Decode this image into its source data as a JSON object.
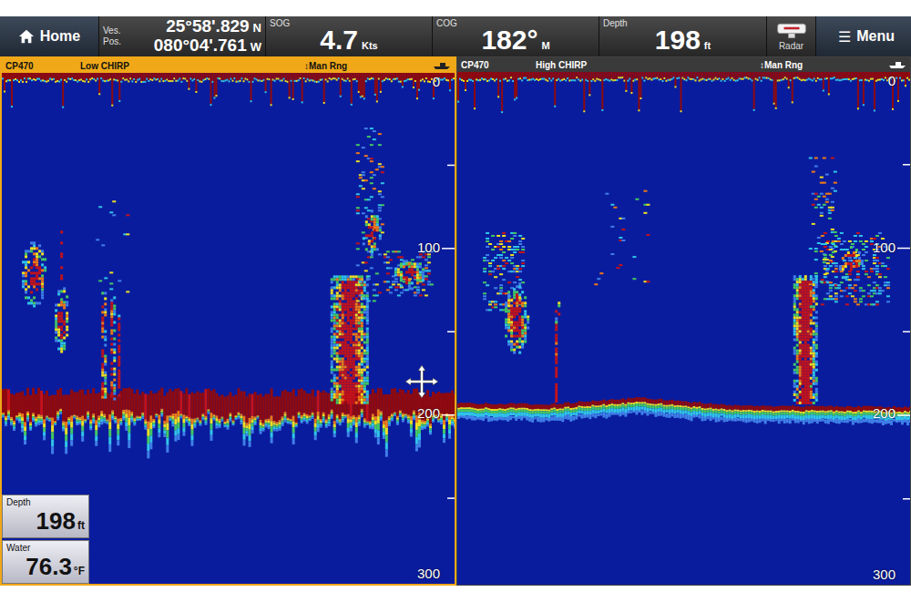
{
  "top_bar": {
    "home": {
      "label": "Home"
    },
    "position": {
      "label_lines": [
        "Ves.",
        "Pos."
      ],
      "latitude": "25°58'.829",
      "lat_hemisphere": "N",
      "longitude": "080°04'.761",
      "lon_hemisphere": "W"
    },
    "readouts": [
      {
        "label": "SOG",
        "value": "4.7",
        "unit": "Kts"
      },
      {
        "label": "COG",
        "value": "182°",
        "unit": "M"
      },
      {
        "label": "Depth",
        "value": "198",
        "unit": "ft"
      }
    ],
    "radar": {
      "label": "Radar"
    },
    "menu": {
      "icon": "☰",
      "label": "Menu"
    }
  },
  "panels": [
    {
      "source": "CP470",
      "mode": "Low CHIRP",
      "range": "↕Man Rng",
      "selected": true,
      "scale": [
        "0",
        "100",
        "200",
        "300"
      ]
    },
    {
      "source": "CP470",
      "mode": "High CHIRP",
      "range": "↕Man Rng",
      "selected": false,
      "scale": [
        "0",
        "100",
        "200",
        "300"
      ]
    }
  ],
  "data_boxes": [
    {
      "label": "Depth",
      "value": "198",
      "unit": "ft"
    },
    {
      "label": "Water",
      "value": "76.3",
      "unit": "°F"
    }
  ]
}
